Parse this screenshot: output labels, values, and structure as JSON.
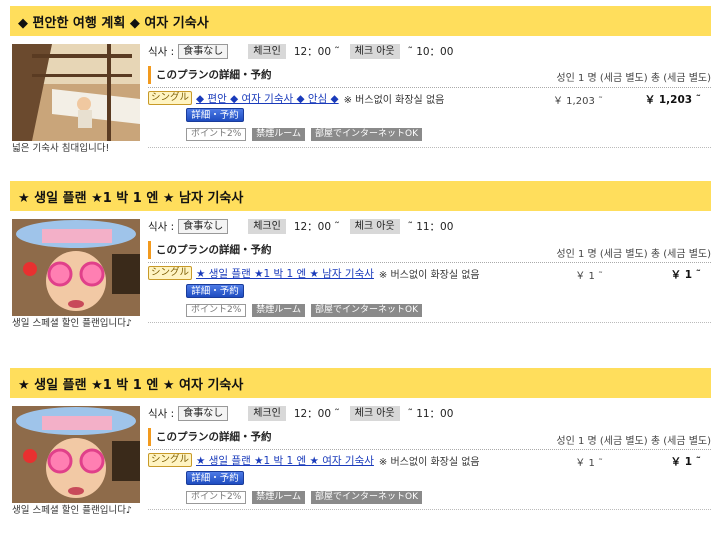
{
  "labels": {
    "meal": "식사 :",
    "checkin": "체크인",
    "checkout": "체크 아웃",
    "detail_title": "このプランの詳細・予約",
    "price_header": "성인 1 명 (세금 별도) 총 (세금 별도)",
    "single": "シングル",
    "detail_button": "詳細・予約",
    "point": "ポイント2%",
    "nosmoking": "禁煙ルーム",
    "internet": "部屋でインターネットOK"
  },
  "plans": [
    {
      "title": "◆ 편안한 여행 계획 ◆ 여자 기숙사",
      "caption": "넓은 기숙사 침대입니다!",
      "meal": "食事なし",
      "checkin_time": "12：00 ˜",
      "checkout_time": "˜ 10：00",
      "link": "◆ 편안 ◆ 여자 기숙사 ◆ 안심 ◆",
      "note": "※ 버스없이 화장실 없음",
      "price_adult": "￥ 1,203 ˜",
      "price_total": "￥ 1,203 ˜"
    },
    {
      "title": "★ 생일 플랜 ★1 박 1 엔 ★ 남자 기숙사",
      "caption": "생일 스페셜 할인 플랜입니다♪",
      "meal": "食事なし",
      "checkin_time": "12：00 ˜",
      "checkout_time": "˜ 11：00",
      "link": "★ 생일 플랜 ★1 박 1 엔 ★ 남자 기숙사",
      "note": "※ 버스없이 화장실 없음",
      "price_adult": "￥ 1 ˜",
      "price_total": "￥ 1 ˜"
    },
    {
      "title": "★ 생일 플랜 ★1 박 1 엔 ★ 여자 기숙사",
      "caption": "생일 스페셜 할인 플랜입니다♪",
      "meal": "食事なし",
      "checkin_time": "12：00 ˜",
      "checkout_time": "˜ 11：00",
      "link": "★ 생일 플랜 ★1 박 1 엔 ★ 여자 기숙사",
      "note": "※ 버스없이 화장실 없음",
      "price_adult": "￥ 1 ˜",
      "price_total": "￥ 1 ˜"
    }
  ]
}
